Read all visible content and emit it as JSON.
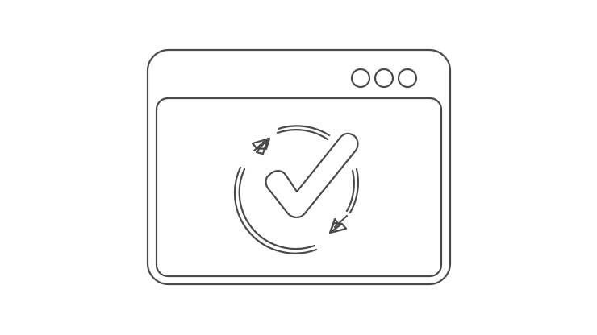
{
  "illustration": {
    "subject": "browser-window-with-sync-checkmark",
    "stroke_color": "#4a4a4a",
    "background_color": "#ffffff",
    "window_controls_count": 3,
    "icons": [
      "browser-window-icon",
      "checkmark-icon",
      "sync-arrows-icon"
    ]
  }
}
